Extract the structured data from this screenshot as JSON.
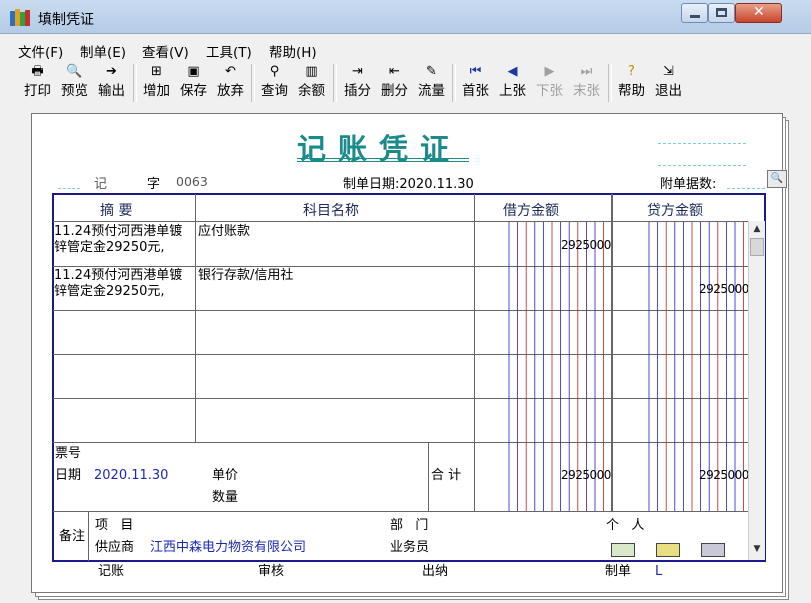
{
  "window": {
    "title": "填制凭证"
  },
  "menu": [
    "文件(F)",
    "制单(E)",
    "查看(V)",
    "工具(T)",
    "帮助(H)"
  ],
  "toolbar": {
    "print": "打印",
    "preview": "预览",
    "output": "输出",
    "add": "增加",
    "save": "保存",
    "discard": "放弃",
    "query": "查询",
    "balance": "余额",
    "insert_entry": "插分",
    "delete_entry": "删分",
    "flow": "流量",
    "first": "首张",
    "prev": "上张",
    "next": "下张",
    "last": "末张",
    "help": "帮助",
    "exit": "退出"
  },
  "voucher": {
    "title": "记账凭证",
    "type_label": "记",
    "zi_label": "字",
    "number": "0063",
    "date_label": "制单日期:2020.11.30",
    "attachments_label": "附单据数:",
    "columns": {
      "summary": "摘 要",
      "account": "科目名称",
      "debit": "借方金额",
      "credit": "贷方金额"
    },
    "rows": [
      {
        "summary": "11.24预付河西港单镀锌管定金29250元,",
        "account": "应付账款",
        "debit": "2925000",
        "credit": ""
      },
      {
        "summary": "11.24预付河西港单镀锌管定金29250元,",
        "account": "银行存款/信用社",
        "debit": "",
        "credit": "2925000"
      }
    ],
    "ticket_label": "票号",
    "date_field_label": "日期",
    "date_value": "2020.11.30",
    "unit_price_label": "单价",
    "quantity_label": "数量",
    "total_label": "合 计",
    "total_debit": "2925000",
    "total_credit": "2925000",
    "remarks_label": "备注",
    "project_label": "项   目",
    "department_label": "部   门",
    "person_label": "个   人",
    "supplier_label": "供应商",
    "supplier_value": "江西中森电力物资有限公司",
    "salesman_label": "业务员",
    "footer": {
      "bookkeeping": "记账",
      "review": "审核",
      "cashier": "出纳",
      "maker_label": "制单",
      "maker_value": "L"
    }
  },
  "colors": {
    "title": "#1a8a8a",
    "grid_border": "#1a1a8a",
    "debit_line_red": "#c02020",
    "debit_line_blue": "#2020c0"
  }
}
